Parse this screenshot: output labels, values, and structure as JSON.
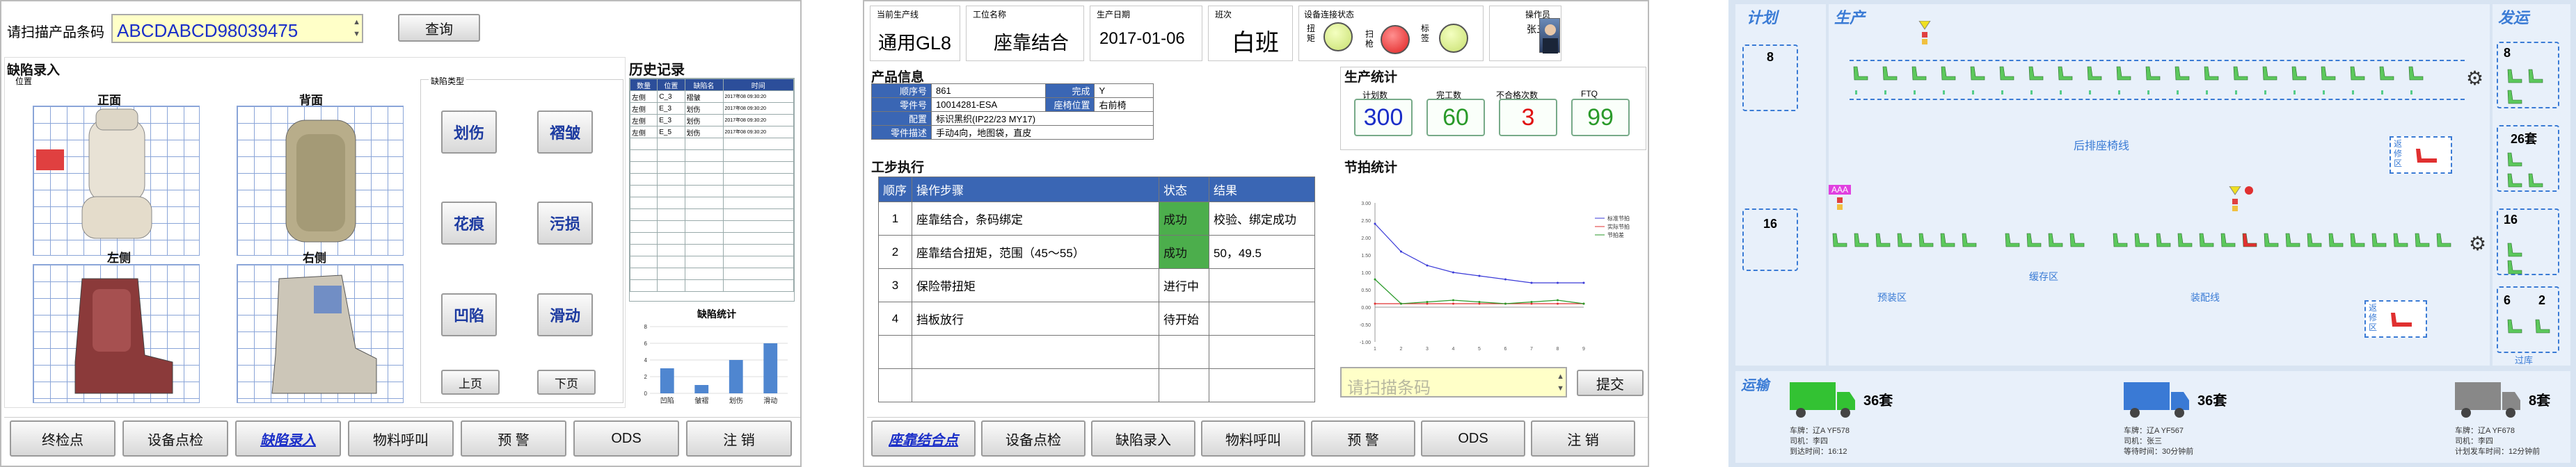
{
  "p1": {
    "scan_label": "请扫描产品条码",
    "scan_value": "ABCDABCD98039475",
    "query_btn": "查询",
    "defect_entry_title": "缺陷录入",
    "position_label": "位置",
    "views": {
      "front": "正面",
      "back": "背面",
      "left": "左侧",
      "right": "右侧"
    },
    "defect_type_label": "缺陷类型",
    "defect_buttons": [
      "划伤",
      "褶皱",
      "花痕",
      "污损",
      "凹陷",
      "滑动"
    ],
    "prev_btn": "上页",
    "next_btn": "下页",
    "history_title": "历史记录",
    "history_headers": [
      "数量",
      "位置",
      "缺陷名",
      "时间"
    ],
    "history_rows": [
      [
        "左侧",
        "C_3",
        "褶皱",
        "2017年08 09:30:20"
      ],
      [
        "左侧",
        "E_3",
        "划伤",
        "2017年08 09:30:20"
      ],
      [
        "左侧",
        "E_3",
        "划伤",
        "2017年08 09:30:20"
      ],
      [
        "左侧",
        "E_5",
        "划伤",
        "2017年08 09:30:20"
      ]
    ],
    "chart_title": "缺陷统计",
    "nav": [
      "终检点",
      "设备点检",
      "缺陷录入",
      "物料呼叫",
      "预 警",
      "ODS",
      "注 销"
    ],
    "nav_active": 2
  },
  "p2": {
    "header": {
      "line_label": "当前生产线",
      "line_value": "通用GL8",
      "station_label": "工位名称",
      "station_value": "座靠结合",
      "date_label": "生产日期",
      "date_value": "2017-01-06",
      "shift_label": "班次",
      "shift_value": "白班",
      "device_label": "设备连接状态",
      "lamps": [
        "扭矩",
        "扫枪",
        "标签"
      ],
      "operator_label": "操作员",
      "operator_value": "张三"
    },
    "product": {
      "title": "产品信息",
      "seq_label": "顺序号",
      "seq_value": "861",
      "complete_label": "完成",
      "complete_value": "Y",
      "part_label": "零件号",
      "part_value": "10014281-ESA",
      "seatpos_label": "座椅位置",
      "seatpos_value": "右前椅",
      "config_label": "配置",
      "config_value": "标识黑织(IP22/23 MY17)",
      "desc_label": "零件描述",
      "desc_value": "手动4向，地图袋，直皮"
    },
    "stats": {
      "title": "生产统计",
      "plan_label": "计划数",
      "plan_value": "300",
      "done_label": "完工数",
      "done_value": "60",
      "fail_label": "不合格次数",
      "fail_value": "3",
      "ftq_label": "FTQ",
      "ftq_value": "99"
    },
    "steps": {
      "title": "工步执行",
      "headers": [
        "顺序",
        "操作步骤",
        "状态",
        "结果"
      ],
      "rows": [
        [
          "1",
          "座靠结合，条码绑定",
          "成功",
          "校验、绑定成功"
        ],
        [
          "2",
          "座靠结合扭矩，范围（45～55）",
          "成功",
          "50，49.5"
        ],
        [
          "3",
          "保险带扭矩",
          "进行中",
          ""
        ],
        [
          "4",
          "挡板放行",
          "待开始",
          ""
        ]
      ]
    },
    "takt": {
      "title": "节拍统计",
      "legend": [
        "标准节拍",
        "实际节拍",
        "节拍差"
      ]
    },
    "scan_placeholder": "请扫描条码",
    "submit_btn": "提交",
    "nav": [
      "座靠结合点",
      "设备点检",
      "缺陷录入",
      "物料呼叫",
      "预 警",
      "ODS",
      "注 销"
    ],
    "nav_active": 0
  },
  "p3": {
    "plan_title": "计划",
    "prod_title": "生产",
    "ship_title": "发运",
    "plan_counts": [
      "8",
      "16"
    ],
    "ship_counts": [
      "8",
      "26套",
      "16",
      "6",
      "2"
    ],
    "ship_bottom": "过库",
    "line_rear": "后排座椅线",
    "rework": "返修区",
    "zones": [
      "预装区",
      "缓存区",
      "装配线"
    ],
    "tag_aaa": "AAA",
    "transport_title": "运输",
    "trucks": [
      {
        "count": "36套",
        "color": "#33c233",
        "line1": "车牌：辽A YF578",
        "line2": "司机：李四",
        "line3": "到达时间：16:12"
      },
      {
        "count": "36套",
        "color": "#3a7ad5",
        "line1": "车牌：辽A YF567",
        "line2": "司机：张三",
        "line3": "等待时间：30分钟前"
      },
      {
        "count": "8套",
        "color": "#888888",
        "line1": "车牌：辽A YF678",
        "line2": "司机：李四",
        "line3": "计划发车时间：12分钟前"
      }
    ]
  },
  "chart_data": [
    {
      "type": "bar",
      "title": "缺陷统计",
      "categories": [
        "凹陷",
        "皱褶",
        "划伤",
        "滑动"
      ],
      "values": [
        3,
        1,
        4,
        6
      ],
      "ylim": [
        0,
        8
      ]
    },
    {
      "type": "line",
      "title": "节拍统计",
      "x": [
        1,
        2,
        3,
        4,
        5,
        6,
        7,
        8,
        9
      ],
      "series": [
        {
          "name": "标准节拍",
          "values": [
            2.4,
            1.6,
            1.2,
            1.0,
            0.9,
            0.8,
            0.7,
            0.7,
            0.7
          ]
        },
        {
          "name": "实际节拍",
          "values": [
            0.1,
            0.1,
            0.1,
            0.1,
            0.1,
            0.1,
            0.1,
            0.1,
            0.1
          ]
        },
        {
          "name": "节拍差",
          "values": [
            0.8,
            0.1,
            0.15,
            0.2,
            0.15,
            0.1,
            0.15,
            0.2,
            0.1
          ]
        }
      ],
      "ylim": [
        -1,
        3
      ]
    }
  ]
}
